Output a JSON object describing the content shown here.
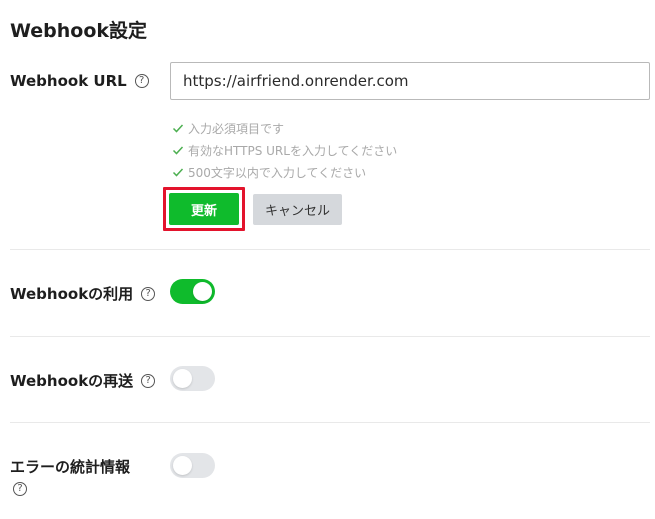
{
  "section": {
    "title": "Webhook設定"
  },
  "webhook_url": {
    "label": "Webhook URL",
    "value": "https://airfriend.onrender.com",
    "help_icon": "question-circle-icon"
  },
  "validation": {
    "items": [
      "入力必須項目です",
      "有効なHTTPS URLを入力してください",
      "500文字以内で入力してください"
    ],
    "icon": "check-icon",
    "color": "#4caf50"
  },
  "buttons": {
    "update_label": "更新",
    "cancel_label": "キャンセル"
  },
  "toggles": {
    "use_webhook": {
      "label": "Webhookの利用",
      "state": "on"
    },
    "resend_webhook": {
      "label": "Webhookの再送",
      "state": "off"
    },
    "error_stats": {
      "label": "エラーの統計情報",
      "state": "off"
    }
  },
  "help_glyph": "?",
  "colors": {
    "accent": "#0fbb2c",
    "highlight": "#e3132c",
    "toggle_off": "#e3e5e8"
  }
}
